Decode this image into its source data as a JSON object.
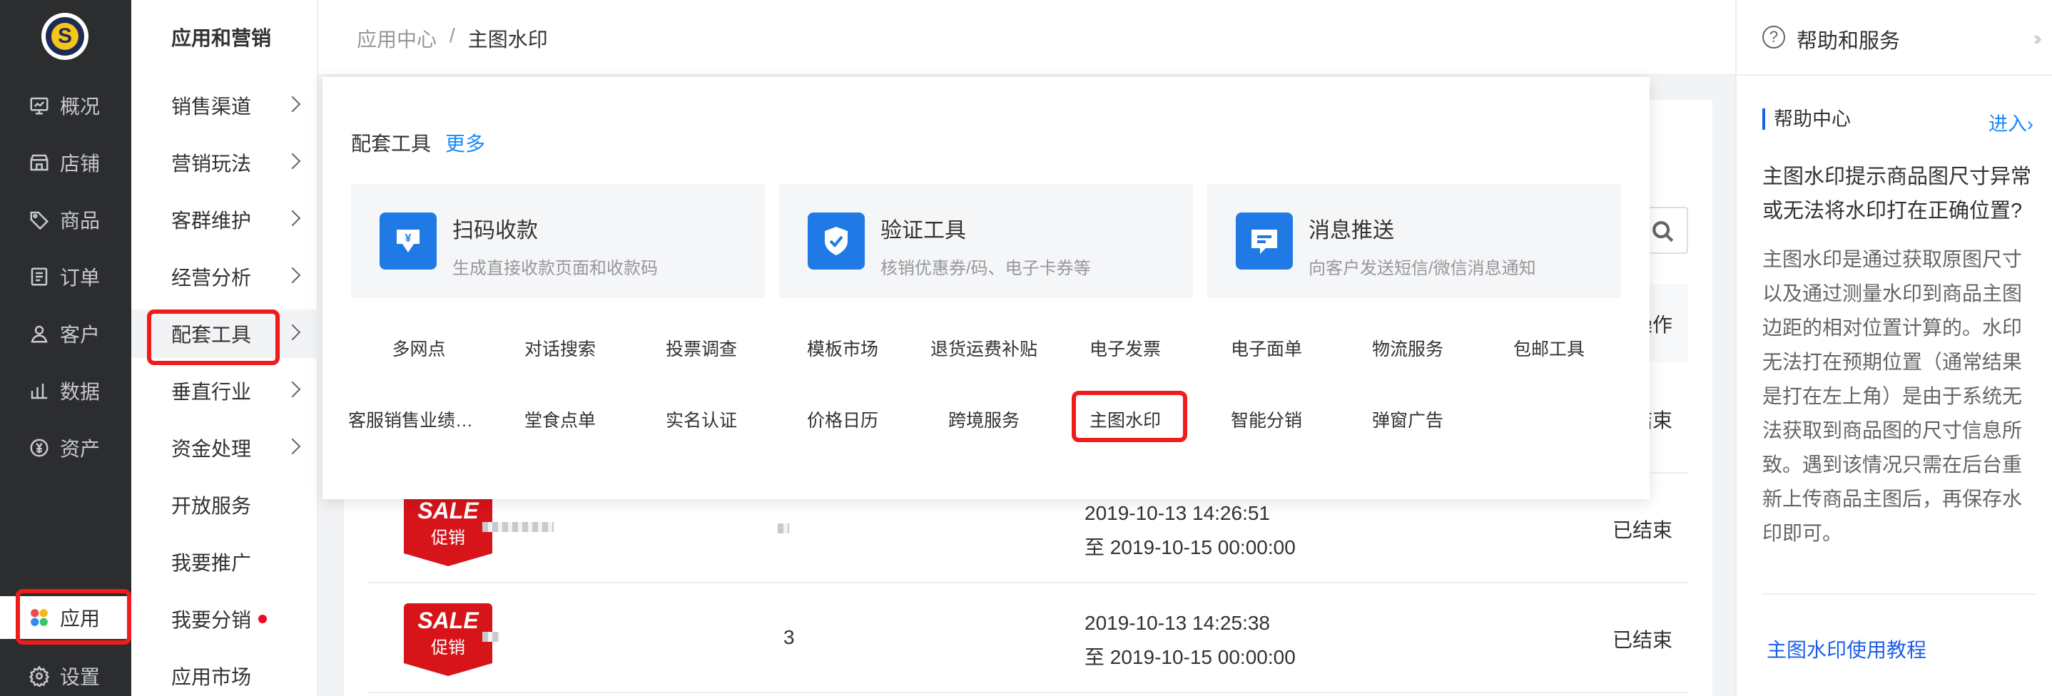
{
  "sidebar_primary": {
    "items": [
      {
        "label": "概况",
        "icon": "dashboard-icon"
      },
      {
        "label": "店铺",
        "icon": "store-icon"
      },
      {
        "label": "商品",
        "icon": "tag-icon"
      },
      {
        "label": "订单",
        "icon": "order-icon"
      },
      {
        "label": "客户",
        "icon": "user-icon"
      },
      {
        "label": "数据",
        "icon": "bar-chart-icon"
      },
      {
        "label": "资产",
        "icon": "yuan-icon"
      },
      {
        "label": "应用",
        "icon": "apps-icon"
      },
      {
        "label": "设置",
        "icon": "gear-icon"
      }
    ],
    "active": "应用"
  },
  "sidebar_secondary": {
    "title": "应用和营销",
    "items": [
      {
        "label": "销售渠道"
      },
      {
        "label": "营销玩法"
      },
      {
        "label": "客群维护"
      },
      {
        "label": "经营分析"
      },
      {
        "label": "配套工具"
      },
      {
        "label": "垂直行业"
      },
      {
        "label": "资金处理"
      },
      {
        "label": "开放服务"
      },
      {
        "label": "我要推广"
      },
      {
        "label": "我要分销"
      },
      {
        "label": "应用市场"
      }
    ],
    "selected": "配套工具"
  },
  "breadcrumb": {
    "parent": "应用中心",
    "separator": "/",
    "current": "主图水印"
  },
  "dropdown": {
    "title": "配套工具",
    "more": "更多",
    "featured": [
      {
        "name": "扫码收款",
        "desc": "生成直接收款页面和收款码",
        "icon": "qr-pay-icon"
      },
      {
        "name": "验证工具",
        "desc": "核销优惠券/码、电子卡券等",
        "icon": "shield-check-icon"
      },
      {
        "name": "消息推送",
        "desc": "向客户发送短信/微信消息通知",
        "icon": "message-icon"
      }
    ],
    "tools_row1": [
      "多网点",
      "对话搜索",
      "投票调查",
      "模板市场",
      "退货运费补贴",
      "电子发票",
      "电子面单",
      "物流服务",
      "包邮工具"
    ],
    "tools_row2": [
      "客服销售业绩报表",
      "堂食点单",
      "实名认证",
      "价格日历",
      "跨境服务",
      "主图水印",
      "智能分销",
      "弹窗广告"
    ],
    "highlighted": "主图水印"
  },
  "table": {
    "header_op": "操作",
    "rows": [
      {
        "badge_top": "SALE",
        "badge_bottom": "促销",
        "count": "",
        "time_start": "",
        "time_end": "",
        "status": "已结束"
      },
      {
        "badge_top": "SALE",
        "badge_bottom": "促销",
        "count": "",
        "time_start": "2019-10-13 14:26:51",
        "time_end": "至 2019-10-15 00:00:00",
        "status": "已结束"
      },
      {
        "badge_top": "SALE",
        "badge_bottom": "促销",
        "count": "3",
        "time_start": "2019-10-13 14:25:38",
        "time_end": "至 2019-10-15 00:00:00",
        "status": "已结束"
      }
    ]
  },
  "help": {
    "header": "帮助和服务",
    "section_title": "帮助中心",
    "enter": "进入",
    "question": "主图水印提示商品图尺寸异常或无法将水印打在正确位置?",
    "answer": "主图水印是通过获取原图尺寸以及通过测量水印到商品主图边距的相对位置计算的。水印无法打在预期位置（通常结果是打在左上角）是由于系统无法获取到商品图的尺寸信息所致。遇到该情况只需在后台重新上传商品主图后，再保存水印即可。",
    "tutorial_link": "主图水印使用教程"
  },
  "colors": {
    "accent_blue": "#1989fa",
    "highlight_red": "#f01c1c",
    "sidebar_dark": "#2c2d2f",
    "sale_red": "#d7141a"
  }
}
